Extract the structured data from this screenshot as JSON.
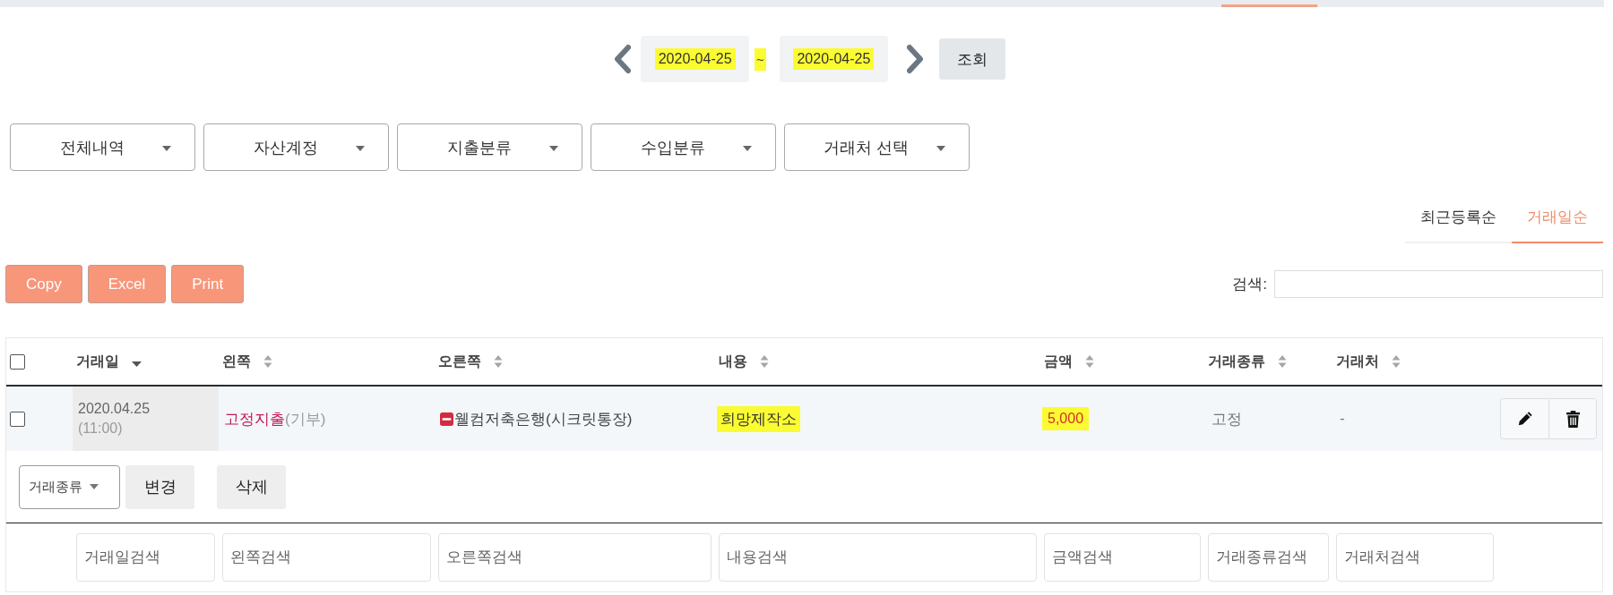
{
  "date_range": {
    "from": "2020-04-25",
    "separator": "~",
    "to": "2020-04-25",
    "highlighted": true,
    "button": "조회"
  },
  "filters": [
    {
      "label": "전체내역"
    },
    {
      "label": "자산계정"
    },
    {
      "label": "지출분류"
    },
    {
      "label": "수입분류"
    },
    {
      "label": "거래처 선택"
    }
  ],
  "sort_tabs": [
    {
      "label": "최근등록순",
      "selected": false
    },
    {
      "label": "거래일순",
      "selected": true
    }
  ],
  "export_buttons": [
    {
      "label": "Copy"
    },
    {
      "label": "Excel"
    },
    {
      "label": "Print"
    }
  ],
  "search": {
    "label": "검색:"
  },
  "table": {
    "select_all": {
      "checked": false
    },
    "columns": [
      {
        "label": "거래일",
        "sorted": true
      },
      {
        "label": "왼쪽",
        "sorted": false
      },
      {
        "label": "오른쪽",
        "sorted": false
      },
      {
        "label": "내용",
        "sorted": false
      },
      {
        "label": "금액",
        "sorted": false
      },
      {
        "label": "거래종류",
        "sorted": false
      },
      {
        "label": "거래처",
        "sorted": false
      }
    ],
    "rows": [
      {
        "checked": false,
        "date": "2020.04.25",
        "time": "(11:00)",
        "left": {
          "name": "고정지출",
          "detail": "(기부)"
        },
        "right": "웰컴저축은행(시크릿통장)",
        "content": {
          "text": "희망제작소",
          "highlighted": true
        },
        "amount": {
          "text": "5,000",
          "highlighted": true
        },
        "type": "고정",
        "counterparty": "-"
      }
    ]
  },
  "bulk_actions": {
    "select": "거래종류",
    "buttons": [
      {
        "label": "변경"
      },
      {
        "label": "삭제"
      }
    ]
  },
  "column_filters": [
    {
      "placeholder": "거래일검색"
    },
    {
      "placeholder": "왼쪽검색"
    },
    {
      "placeholder": "오른쪽검색"
    },
    {
      "placeholder": "내용검색"
    },
    {
      "placeholder": "금액검색"
    },
    {
      "placeholder": "거래종류검색"
    },
    {
      "placeholder": "거래처검색"
    }
  ]
}
